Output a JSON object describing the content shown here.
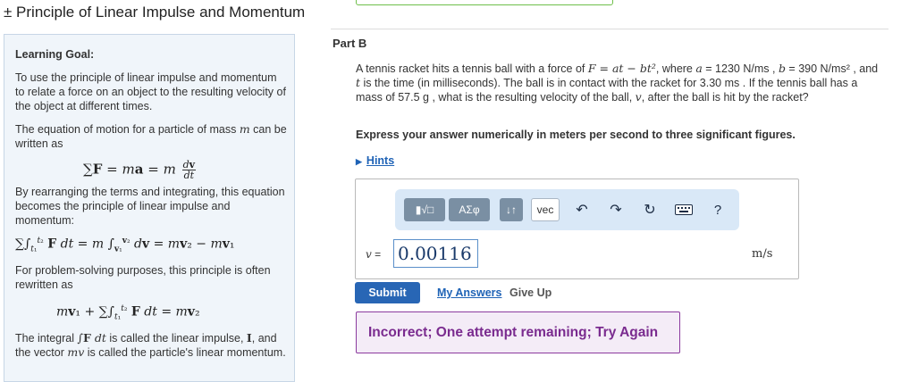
{
  "page": {
    "title": "± Principle of Linear Impulse and Momentum"
  },
  "learning_goal": {
    "heading": "Learning Goal:",
    "intro": "To use the principle of linear impulse and momentum to relate a force on an object to the resulting velocity of the object at different times.",
    "eom_text_1": "The equation of motion for a particle of mass ",
    "eom_mass": "m",
    "eom_text_2": " can be written as",
    "integrating_text": "By rearranging the terms and integrating, this equation becomes the principle of linear impulse and momentum:",
    "rewritten_text": "For problem-solving purposes, this principle is often rewritten as",
    "integral_text_1": "The integral ",
    "integral_text_2": " is called the linear impulse, ",
    "impulse_symbol": "I",
    "integral_text_3": ", and the vector ",
    "mv_symbol": "mv",
    "integral_text_4": " is called the particle's linear momentum."
  },
  "part": {
    "label": "Part B"
  },
  "question": {
    "text_1": "A tennis racket hits a tennis ball with a force of ",
    "force_expr": "F = at − bt²",
    "text_2": ", where ",
    "a_sym": "a",
    "a_val": " = 1230 N/ms",
    "text_3": " , ",
    "b_sym": "b",
    "b_val": " = 390 N/ms²",
    "text_4": " , and ",
    "t_sym": "t",
    "text_5": " is the time (in milliseconds). The ball is in contact with the racket for 3.30 ms . If the tennis ball has a mass of 57.5 g , what is the resulting velocity of the ball, ",
    "v_sym": "v",
    "text_6": ", after the ball is hit by the racket?"
  },
  "instruction": "Express your answer numerically in meters per second to three significant figures.",
  "hints_label": "Hints",
  "toolbar": {
    "templates_label": "▮√□",
    "greek_label": "ΑΣφ",
    "arrows_label": "↓↑",
    "vec_label": "vec",
    "help_label": "?"
  },
  "answer": {
    "var_label": "v",
    "equals": " =",
    "value": "0.00116",
    "unit": "m/s"
  },
  "actions": {
    "submit": "Submit",
    "my_answers": "My Answers",
    "give_up": "Give Up"
  },
  "feedback": "Incorrect; One attempt remaining; Try Again",
  "colors": {
    "accent": "#2866b5",
    "feedback_border": "#8b3a9e",
    "toolbar_bg": "#d9e8f7"
  }
}
